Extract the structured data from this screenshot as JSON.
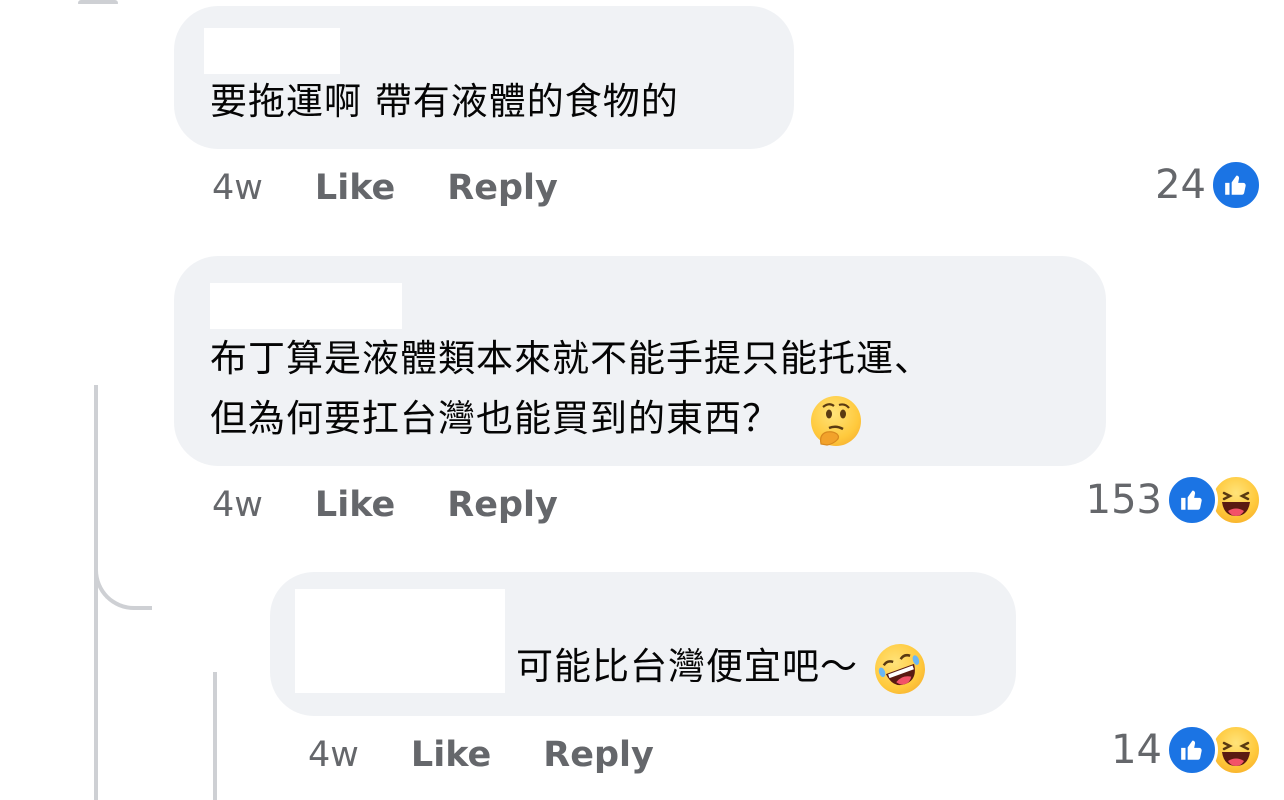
{
  "comments": [
    {
      "text_lines": [
        "要拖運啊 帶有液體的食物的"
      ],
      "time": "4w",
      "like_label": "Like",
      "reply_label": "Reply",
      "reaction_count": "24",
      "reactions": [
        "like-icon"
      ]
    },
    {
      "text_lines": [
        "布丁算是液體類本來就不能手提只能托運、",
        "但為何要扛台灣也能買到的東西？"
      ],
      "emoji": "thinking-face-icon",
      "time": "4w",
      "like_label": "Like",
      "reply_label": "Reply",
      "reaction_count": "153",
      "reactions": [
        "like-icon",
        "haha-icon"
      ]
    },
    {
      "text_lines": [
        "可能比台灣便宜吧～"
      ],
      "emoji": "rolling-laughing-icon",
      "time": "4w",
      "like_label": "Like",
      "reply_label": "Reply",
      "reaction_count": "14",
      "reactions": [
        "like-icon",
        "haha-icon"
      ]
    }
  ],
  "colors": {
    "bubble": "#f0f2f5",
    "meta_text": "#65676b",
    "like_blue": "#1b74e4",
    "thread_line": "#ced0d4"
  }
}
